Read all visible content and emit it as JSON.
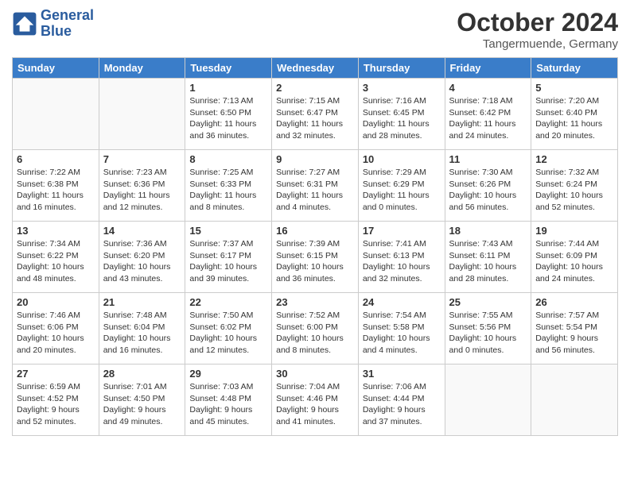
{
  "header": {
    "logo_line1": "General",
    "logo_line2": "Blue",
    "month": "October 2024",
    "location": "Tangermuende, Germany"
  },
  "weekdays": [
    "Sunday",
    "Monday",
    "Tuesday",
    "Wednesday",
    "Thursday",
    "Friday",
    "Saturday"
  ],
  "weeks": [
    [
      {
        "day": "",
        "info": ""
      },
      {
        "day": "",
        "info": ""
      },
      {
        "day": "1",
        "info": "Sunrise: 7:13 AM\nSunset: 6:50 PM\nDaylight: 11 hours\nand 36 minutes."
      },
      {
        "day": "2",
        "info": "Sunrise: 7:15 AM\nSunset: 6:47 PM\nDaylight: 11 hours\nand 32 minutes."
      },
      {
        "day": "3",
        "info": "Sunrise: 7:16 AM\nSunset: 6:45 PM\nDaylight: 11 hours\nand 28 minutes."
      },
      {
        "day": "4",
        "info": "Sunrise: 7:18 AM\nSunset: 6:42 PM\nDaylight: 11 hours\nand 24 minutes."
      },
      {
        "day": "5",
        "info": "Sunrise: 7:20 AM\nSunset: 6:40 PM\nDaylight: 11 hours\nand 20 minutes."
      }
    ],
    [
      {
        "day": "6",
        "info": "Sunrise: 7:22 AM\nSunset: 6:38 PM\nDaylight: 11 hours\nand 16 minutes."
      },
      {
        "day": "7",
        "info": "Sunrise: 7:23 AM\nSunset: 6:36 PM\nDaylight: 11 hours\nand 12 minutes."
      },
      {
        "day": "8",
        "info": "Sunrise: 7:25 AM\nSunset: 6:33 PM\nDaylight: 11 hours\nand 8 minutes."
      },
      {
        "day": "9",
        "info": "Sunrise: 7:27 AM\nSunset: 6:31 PM\nDaylight: 11 hours\nand 4 minutes."
      },
      {
        "day": "10",
        "info": "Sunrise: 7:29 AM\nSunset: 6:29 PM\nDaylight: 11 hours\nand 0 minutes."
      },
      {
        "day": "11",
        "info": "Sunrise: 7:30 AM\nSunset: 6:26 PM\nDaylight: 10 hours\nand 56 minutes."
      },
      {
        "day": "12",
        "info": "Sunrise: 7:32 AM\nSunset: 6:24 PM\nDaylight: 10 hours\nand 52 minutes."
      }
    ],
    [
      {
        "day": "13",
        "info": "Sunrise: 7:34 AM\nSunset: 6:22 PM\nDaylight: 10 hours\nand 48 minutes."
      },
      {
        "day": "14",
        "info": "Sunrise: 7:36 AM\nSunset: 6:20 PM\nDaylight: 10 hours\nand 43 minutes."
      },
      {
        "day": "15",
        "info": "Sunrise: 7:37 AM\nSunset: 6:17 PM\nDaylight: 10 hours\nand 39 minutes."
      },
      {
        "day": "16",
        "info": "Sunrise: 7:39 AM\nSunset: 6:15 PM\nDaylight: 10 hours\nand 36 minutes."
      },
      {
        "day": "17",
        "info": "Sunrise: 7:41 AM\nSunset: 6:13 PM\nDaylight: 10 hours\nand 32 minutes."
      },
      {
        "day": "18",
        "info": "Sunrise: 7:43 AM\nSunset: 6:11 PM\nDaylight: 10 hours\nand 28 minutes."
      },
      {
        "day": "19",
        "info": "Sunrise: 7:44 AM\nSunset: 6:09 PM\nDaylight: 10 hours\nand 24 minutes."
      }
    ],
    [
      {
        "day": "20",
        "info": "Sunrise: 7:46 AM\nSunset: 6:06 PM\nDaylight: 10 hours\nand 20 minutes."
      },
      {
        "day": "21",
        "info": "Sunrise: 7:48 AM\nSunset: 6:04 PM\nDaylight: 10 hours\nand 16 minutes."
      },
      {
        "day": "22",
        "info": "Sunrise: 7:50 AM\nSunset: 6:02 PM\nDaylight: 10 hours\nand 12 minutes."
      },
      {
        "day": "23",
        "info": "Sunrise: 7:52 AM\nSunset: 6:00 PM\nDaylight: 10 hours\nand 8 minutes."
      },
      {
        "day": "24",
        "info": "Sunrise: 7:54 AM\nSunset: 5:58 PM\nDaylight: 10 hours\nand 4 minutes."
      },
      {
        "day": "25",
        "info": "Sunrise: 7:55 AM\nSunset: 5:56 PM\nDaylight: 10 hours\nand 0 minutes."
      },
      {
        "day": "26",
        "info": "Sunrise: 7:57 AM\nSunset: 5:54 PM\nDaylight: 9 hours\nand 56 minutes."
      }
    ],
    [
      {
        "day": "27",
        "info": "Sunrise: 6:59 AM\nSunset: 4:52 PM\nDaylight: 9 hours\nand 52 minutes."
      },
      {
        "day": "28",
        "info": "Sunrise: 7:01 AM\nSunset: 4:50 PM\nDaylight: 9 hours\nand 49 minutes."
      },
      {
        "day": "29",
        "info": "Sunrise: 7:03 AM\nSunset: 4:48 PM\nDaylight: 9 hours\nand 45 minutes."
      },
      {
        "day": "30",
        "info": "Sunrise: 7:04 AM\nSunset: 4:46 PM\nDaylight: 9 hours\nand 41 minutes."
      },
      {
        "day": "31",
        "info": "Sunrise: 7:06 AM\nSunset: 4:44 PM\nDaylight: 9 hours\nand 37 minutes."
      },
      {
        "day": "",
        "info": ""
      },
      {
        "day": "",
        "info": ""
      }
    ]
  ]
}
